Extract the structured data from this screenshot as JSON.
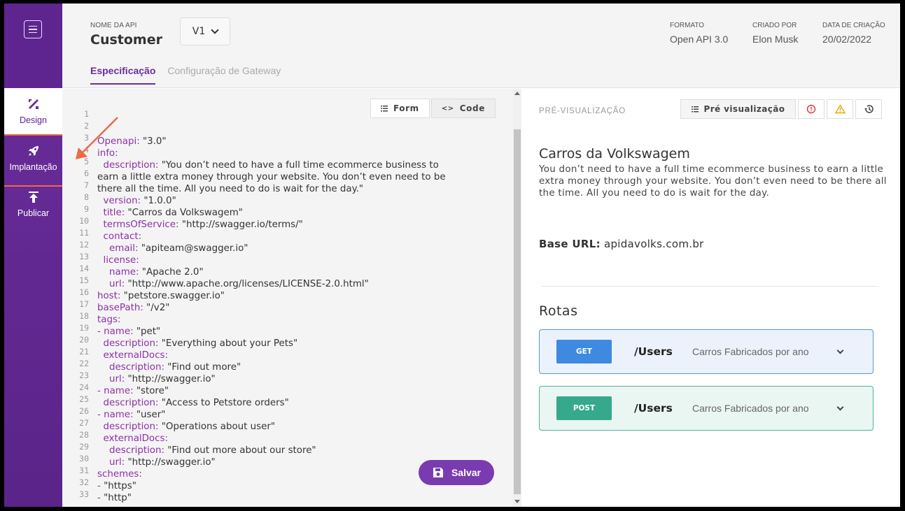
{
  "sidebar": {
    "menu_icon": "hamburger-icon",
    "items": [
      {
        "label": "Design",
        "icon": "design-tools-icon",
        "active": true
      },
      {
        "label": "Implantação",
        "icon": "rocket-icon",
        "active": false
      },
      {
        "label": "Publicar",
        "icon": "upload-icon",
        "active": false
      }
    ]
  },
  "header": {
    "api_label": "NOME DA API",
    "api_name": "Customer",
    "version": "V1",
    "meta": [
      {
        "key": "FORMATO",
        "value": "Open API 3.0"
      },
      {
        "key": "CRIADO POR",
        "value": "Elon Musk"
      },
      {
        "key": "DATA DE CRIAÇÃO",
        "value": "20/02/2022"
      }
    ],
    "tabs": [
      {
        "label": "Especificação",
        "active": true
      },
      {
        "label": "Configuração de Gateway",
        "active": false
      }
    ]
  },
  "editor": {
    "form_label": "Form",
    "code_label": "Code",
    "save_label": "Salvar",
    "line_numbers": [
      "1",
      "2",
      "3",
      "4",
      "5",
      "6",
      "7",
      "8",
      "9",
      "10",
      "11",
      "12",
      "13",
      "14",
      "15",
      "16",
      "17",
      "18",
      "19",
      "20",
      "21",
      "22",
      "23",
      "24",
      "25",
      "26",
      "27",
      "28",
      "29",
      "30",
      "31",
      "32",
      "33"
    ],
    "lines": [
      {
        "k": "Openapi:",
        "v": " \"3.0\"",
        "indent": ""
      },
      {
        "k": "info:",
        "v": "",
        "indent": ""
      },
      {
        "k": "description:",
        "v": " \"You don’t need to have a full time ecommerce business to",
        "indent": "  "
      },
      {
        "k": "",
        "v": "earn a little extra money through your website. You don’t even need to be",
        "indent": ""
      },
      {
        "k": "",
        "v": "there all the time. All you need to do is wait for the day.\"",
        "indent": ""
      },
      {
        "k": "version:",
        "v": " \"1.0.0\"",
        "indent": "  "
      },
      {
        "k": "title:",
        "v": " \"Carros da Volkswagem\"",
        "indent": "  "
      },
      {
        "k": "termsOfService:",
        "v": " \"http://swagger.io/terms/\"",
        "indent": "  "
      },
      {
        "k": "contact:",
        "v": "",
        "indent": "  "
      },
      {
        "k": "email:",
        "v": " \"apiteam@swagger.io\"",
        "indent": "    "
      },
      {
        "k": "license:",
        "v": "",
        "indent": "  "
      },
      {
        "k": "name:",
        "v": " \"Apache 2.0\"",
        "indent": "    "
      },
      {
        "k": "url:",
        "v": " \"http://www.apache.org/licenses/LICENSE-2.0.html\"",
        "indent": "    "
      },
      {
        "k": "host:",
        "v": " \"petstore.swagger.io\"",
        "indent": ""
      },
      {
        "k": "basePath:",
        "v": " \"/v2\"",
        "indent": ""
      },
      {
        "k": "tags:",
        "v": "",
        "indent": ""
      },
      {
        "k": "- name:",
        "v": " \"pet\"",
        "indent": ""
      },
      {
        "k": "description:",
        "v": " \"Everything about your Pets\"",
        "indent": "  "
      },
      {
        "k": "externalDocs:",
        "v": "",
        "indent": "  "
      },
      {
        "k": "description:",
        "v": " \"Find out more\"",
        "indent": "    "
      },
      {
        "k": "url:",
        "v": " \"http://swagger.io\"",
        "indent": "    "
      },
      {
        "k": "- name:",
        "v": " \"store\"",
        "indent": ""
      },
      {
        "k": "description:",
        "v": " \"Access to Petstore orders\"",
        "indent": "  "
      },
      {
        "k": "- name:",
        "v": " \"user\"",
        "indent": ""
      },
      {
        "k": "description:",
        "v": " \"Operations about user\"",
        "indent": "  "
      },
      {
        "k": "externalDocs:",
        "v": "",
        "indent": "  "
      },
      {
        "k": "description:",
        "v": " \"Find out more about our store\"",
        "indent": "    "
      },
      {
        "k": "url:",
        "v": " \"http://swagger.io\"",
        "indent": "    "
      },
      {
        "k": "schemes:",
        "v": "",
        "indent": ""
      },
      {
        "k": "- ",
        "v": "\"https\"",
        "indent": ""
      },
      {
        "k": "- ",
        "v": "\"http\"",
        "indent": ""
      }
    ]
  },
  "preview": {
    "label": "PRÉ-VISUALIZAÇÃO",
    "preview_button": "Pré visualização",
    "title": "Carros da Volkswagem",
    "description": "You don’t need to have a full time ecommerce business to earn a little extra money through your website. You don’t even need to be there all the time. All you need to do is wait for the day.",
    "base_url_label": "Base URL:",
    "base_url": "apidavolks.com.br",
    "routes_title": "Rotas",
    "routes": [
      {
        "method": "GET",
        "path": "/Users",
        "desc": "Carros Fabricados por ano"
      },
      {
        "method": "POST",
        "path": "/Users",
        "desc": "Carros Fabricados por ano"
      }
    ]
  },
  "colors": {
    "brand": "#6b2d9c",
    "get": "#3e8ae0",
    "post": "#36a98d",
    "annotation": "#ee6a45"
  }
}
